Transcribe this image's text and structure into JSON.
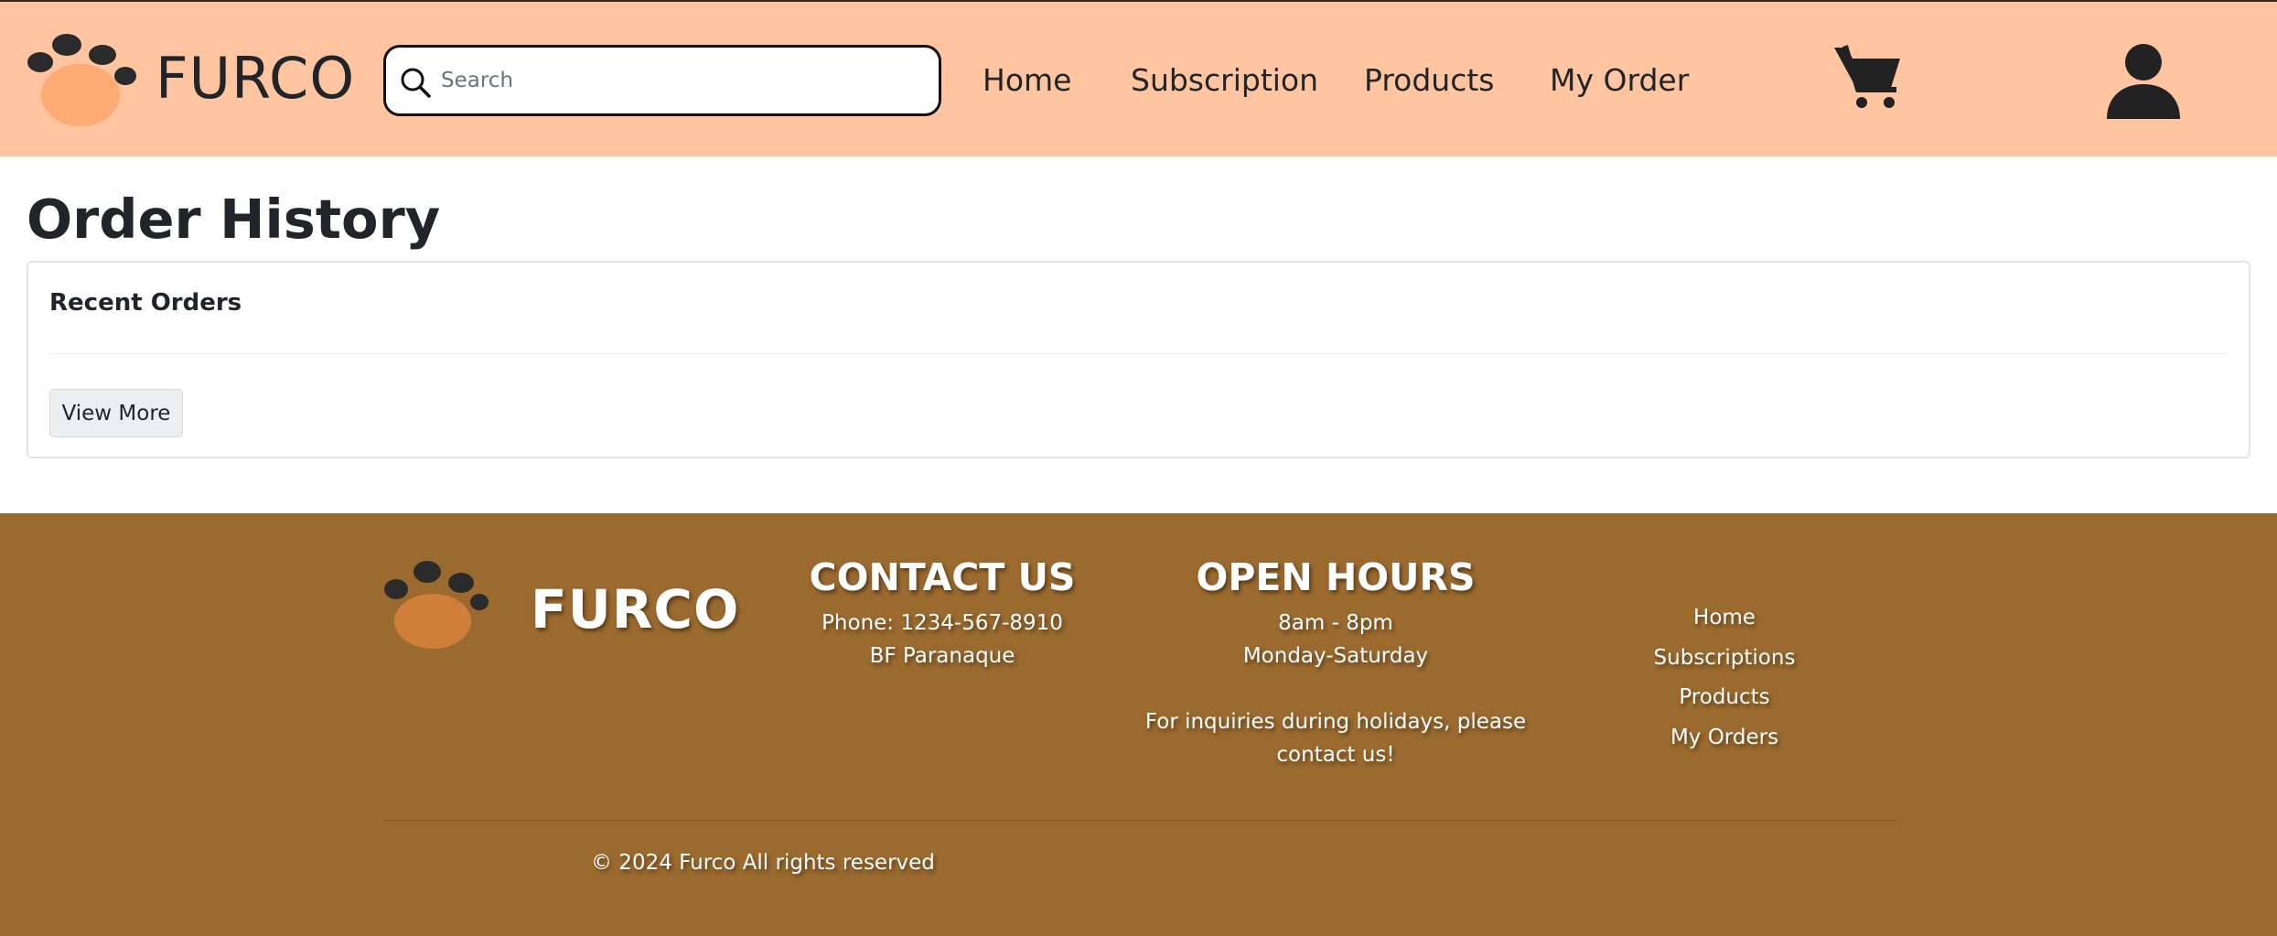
{
  "header": {
    "brand_name": "FURCO",
    "search_placeholder": "Search",
    "nav": [
      "Home",
      "Subscription",
      "Products",
      "My Order"
    ]
  },
  "main": {
    "title": "Order History",
    "card_heading": "Recent Orders",
    "view_more_label": "View More"
  },
  "footer": {
    "brand_name": "FURCO",
    "contact": {
      "heading": "CONTACT US",
      "phone": "Phone: 1234-567-8910",
      "address": "BF Paranaque"
    },
    "hours": {
      "heading": "OPEN HOURS",
      "time": "8am - 8pm",
      "days": "Monday-Saturday",
      "note": "For inquiries during holidays, please contact us!"
    },
    "links": [
      "Home",
      "Subscriptions",
      "Products",
      "My Orders"
    ],
    "copyright": "© 2024 Furco All rights reserved"
  },
  "colors": {
    "header_bg": "#fec5a0",
    "footer_bg": "#9b6a2e",
    "paw_pad_header": "#fdaa73",
    "paw_pad_footer": "#cf7f3a",
    "paw_toes": "#2b2b2b"
  },
  "icons": [
    "paw-logo-icon",
    "search-icon",
    "cart-icon",
    "user-icon"
  ]
}
